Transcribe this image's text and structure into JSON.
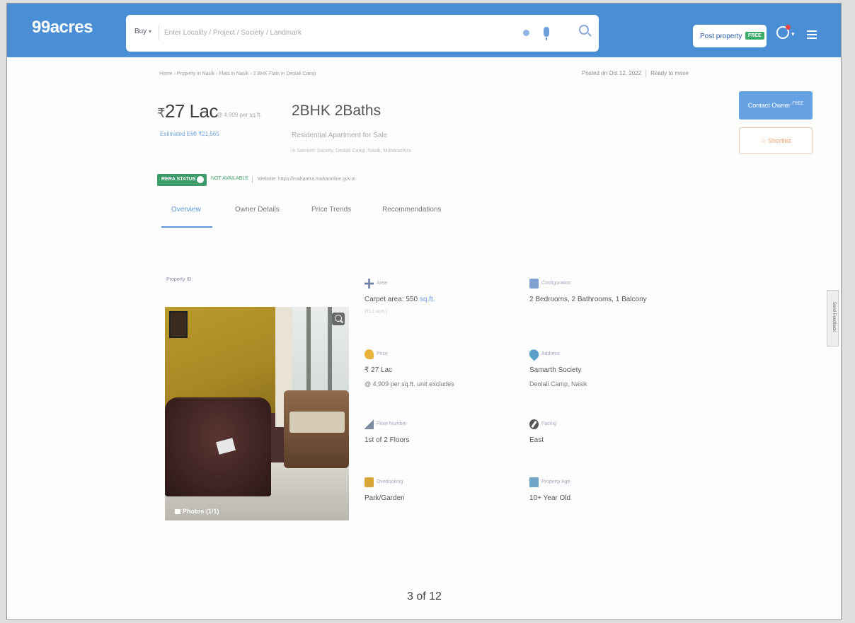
{
  "header": {
    "logo": "99acres",
    "search_type": "Buy",
    "search_placeholder": "Enter Locality / Project / Society / Landmark",
    "post_property_label": "Post property",
    "post_property_badge": "FREE"
  },
  "breadcrumb": "Home › Property in Nasik › Flats in Nasik › 2 BHK Flats in Deolali Camp",
  "posted": {
    "date": "Posted on Oct 12, 2022",
    "status": "Ready to move"
  },
  "summary": {
    "price": "27 Lac",
    "rupee": "₹",
    "price_per_sqft": "@ 4,909 per sq.ft.",
    "estimated_emi": "Estimated EMI ₹21,565",
    "bhk": "2BHK 2Baths",
    "type": "Residential Apartment for Sale",
    "location": "in Samarth Society, Deolali Camp, Nasik, Maharashtra"
  },
  "actions": {
    "contact_owner": "Contact Owner",
    "contact_badge": "FREE",
    "shortlist": "☆ Shortlist"
  },
  "rera": {
    "badge": "RERA STATUS",
    "status": "NOT AVAILABLE",
    "website": "Website: https://maharera.mahaonline.gov.in"
  },
  "tabs": [
    "Overview",
    "Owner Details",
    "Price Trends",
    "Recommendations"
  ],
  "property": {
    "id_label": "Property ID:",
    "photos_label": "Photos (1/1)",
    "details": {
      "area": {
        "label": "Area",
        "value": "Carpet area: 550",
        "unit": "sq.ft.",
        "sub": "(51.1 sq.m.)"
      },
      "configuration": {
        "label": "Configuration",
        "value": "2 Bedrooms, 2 Bathrooms, 1 Balcony"
      },
      "price": {
        "label": "Price",
        "value": "₹ 27 Lac",
        "sub": "@ 4,909 per sq.ft. unit excludes"
      },
      "address": {
        "label": "Address",
        "value": "Samarth Society",
        "sub": "Deolali Camp, Nasik"
      },
      "floor": {
        "label": "Floor Number",
        "value": "1st of 2 Floors"
      },
      "facing": {
        "label": "Facing",
        "value": "East"
      },
      "overlooking": {
        "label": "Overlooking",
        "value": "Park/Garden"
      },
      "age": {
        "label": "Property Age",
        "value": "10+ Year Old"
      }
    }
  },
  "feedback_label": "Send Feedback",
  "page_number": "3 of 12"
}
